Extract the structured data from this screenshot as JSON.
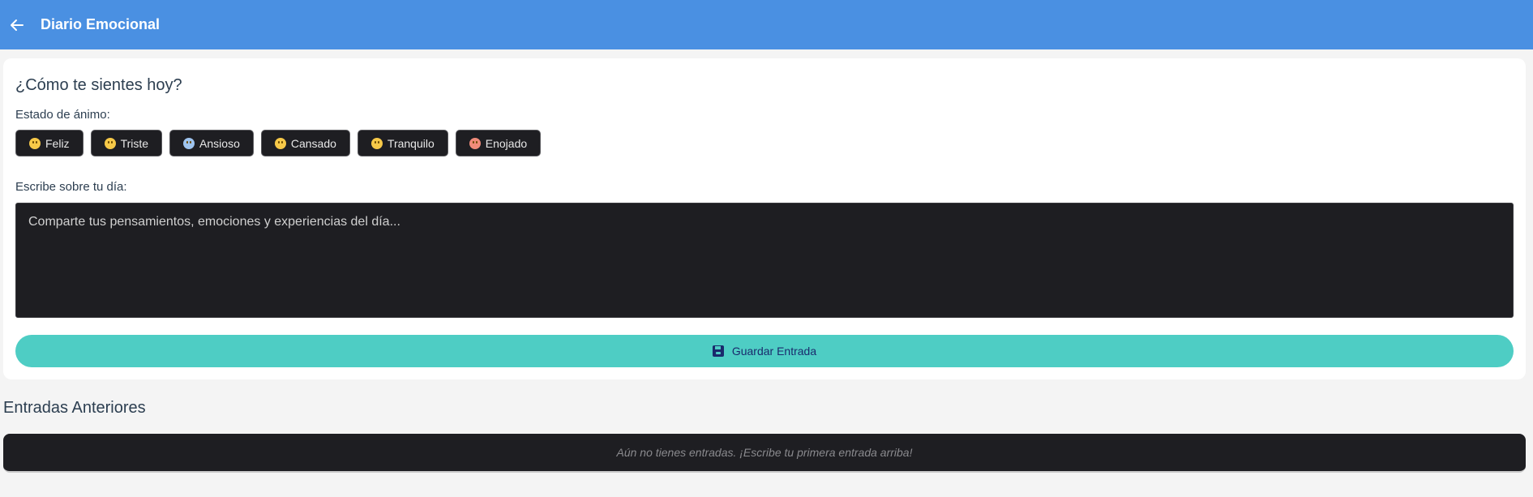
{
  "header": {
    "title": "Diario Emocional",
    "back_icon": "arrow-left-icon",
    "background": "#4a90e2"
  },
  "form": {
    "question": "¿Cómo te sientes hoy?",
    "mood_label": "Estado de ánimo:",
    "moods": [
      {
        "label": "Feliz",
        "icon": "smiling-face-icon"
      },
      {
        "label": "Triste",
        "icon": "sad-face-icon"
      },
      {
        "label": "Ansioso",
        "icon": "anxious-face-icon"
      },
      {
        "label": "Cansado",
        "icon": "tired-face-icon"
      },
      {
        "label": "Tranquilo",
        "icon": "calm-face-icon"
      },
      {
        "label": "Enojado",
        "icon": "angry-face-icon"
      }
    ],
    "write_label": "Escribe sobre tu día:",
    "textarea_placeholder": "Comparte tus pensamientos, emociones y experiencias del día...",
    "textarea_value": "",
    "save_label": "Guardar Entrada",
    "save_icon": "floppy-disk-icon",
    "accent": "#4ecdc4"
  },
  "history": {
    "title": "Entradas Anteriores",
    "empty_message": "Aún no tienes entradas. ¡Escribe tu primera entrada arriba!"
  }
}
